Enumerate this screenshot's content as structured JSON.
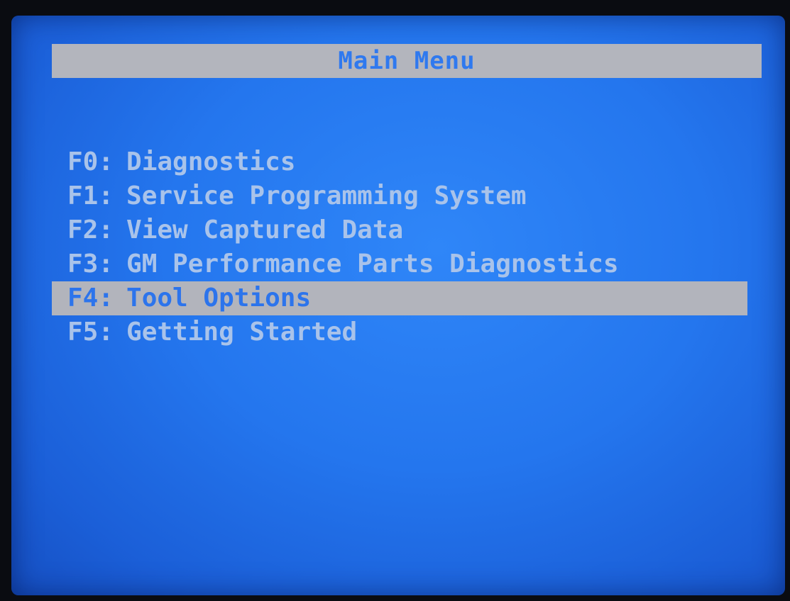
{
  "screen": {
    "title": "Main Menu"
  },
  "menu": {
    "items": [
      {
        "key": "F0:",
        "label": "Diagnostics"
      },
      {
        "key": "F1:",
        "label": "Service Programming System"
      },
      {
        "key": "F2:",
        "label": "View Captured Data"
      },
      {
        "key": "F3:",
        "label": "GM Performance Parts Diagnostics"
      },
      {
        "key": "F4:",
        "label": "Tool Options"
      },
      {
        "key": "F5:",
        "label": "Getting Started"
      }
    ],
    "selected_index": 4
  },
  "colors": {
    "screen_blue": "#2476ee",
    "highlight_gray": "#b2b4bc",
    "menu_text": "#a9c3ea",
    "selected_text": "#2c74ec"
  }
}
